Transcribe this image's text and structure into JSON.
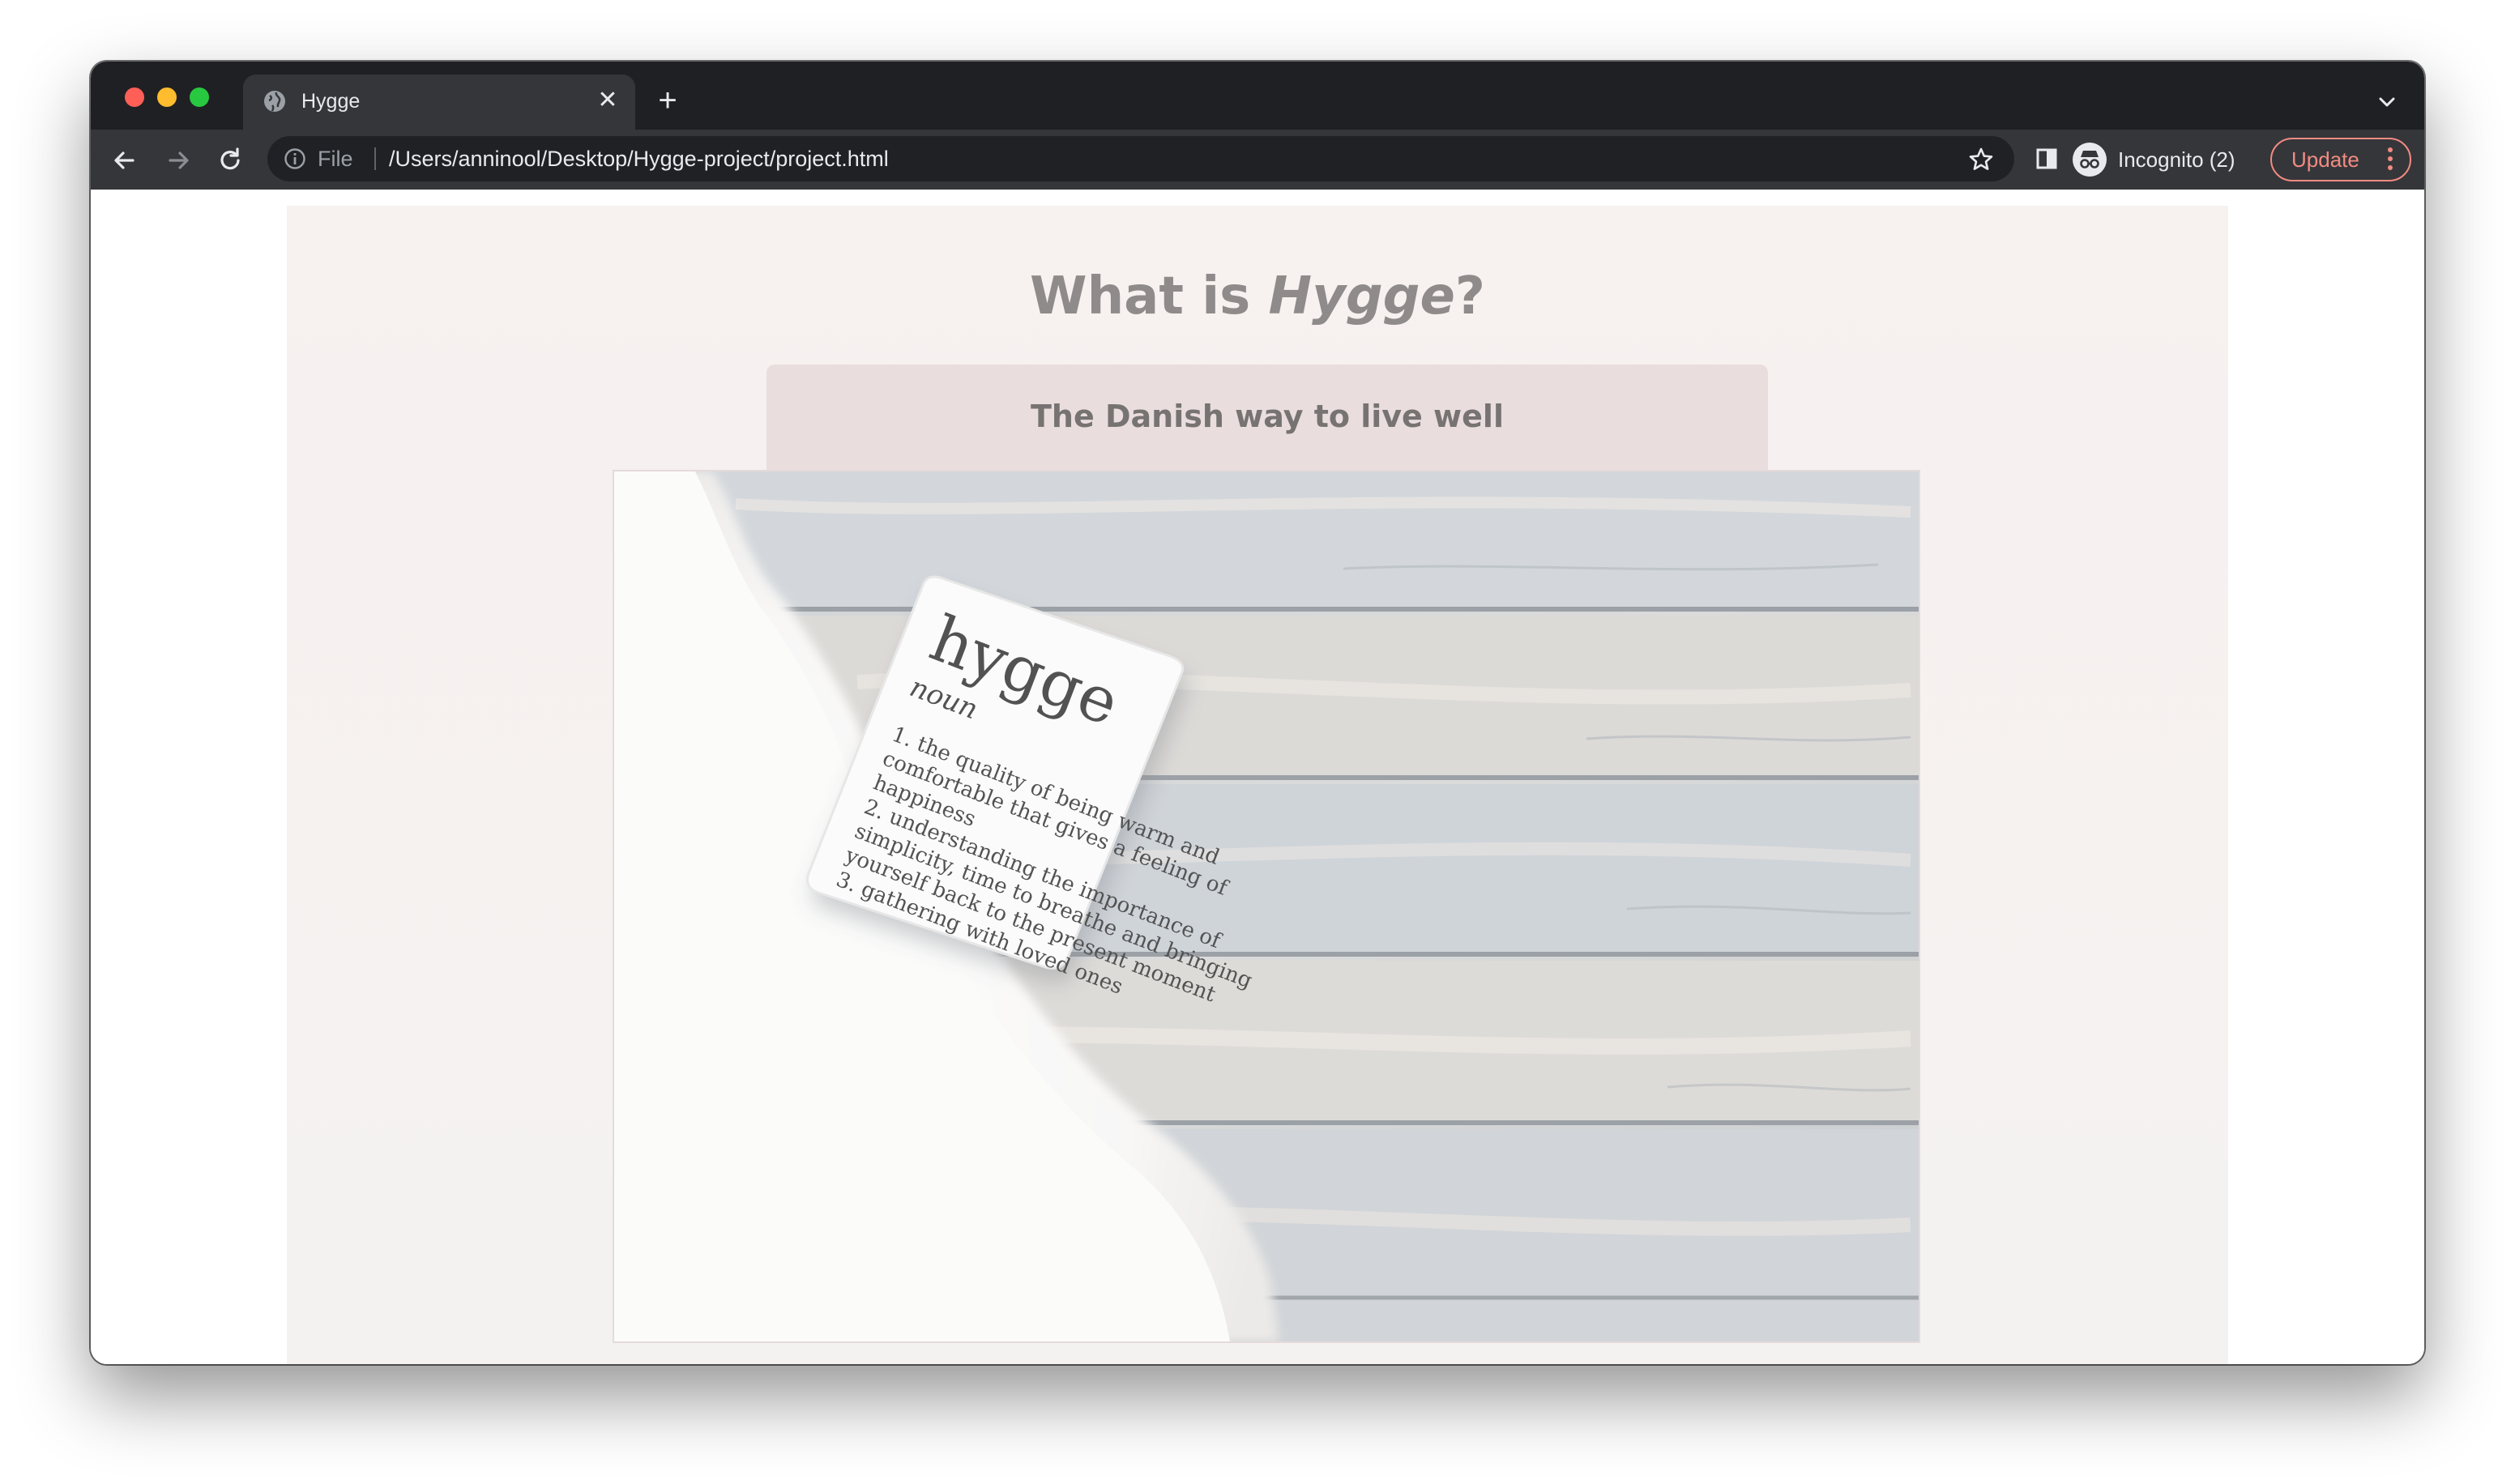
{
  "browser": {
    "tab": {
      "title": "Hygge",
      "close_glyph": "✕",
      "favicon": "globe-icon"
    },
    "new_tab_glyph": "+",
    "toolbar": {
      "scheme_label": "File",
      "url": "/Users/anninool/Desktop/Hygge-project/project.html",
      "profile_label": "Incognito (2)",
      "update_label": "Update"
    },
    "colors": {
      "tabstrip": "#1f2023",
      "toolbar": "#35363a",
      "update_accent": "#f28b82"
    }
  },
  "page": {
    "title_prefix": "What is ",
    "title_emphasis": "Hygge",
    "title_suffix": "?",
    "subtitle": "The Danish way to live well",
    "hero_image": {
      "pillow_word": "hygge",
      "pillow_pos": "noun",
      "definition_lines": [
        "1. the quality of being warm and",
        "comfortable that gives a feeling of",
        "happiness",
        "2. understanding the importance of",
        "simplicity, time to breathe and bringing",
        "yourself back to the present moment",
        "3. gathering with loved ones"
      ]
    },
    "colors": {
      "card_bg": "#f7f1f0",
      "subtitle_bg": "#e9dddd",
      "title_text": "#8f8b8b"
    }
  }
}
